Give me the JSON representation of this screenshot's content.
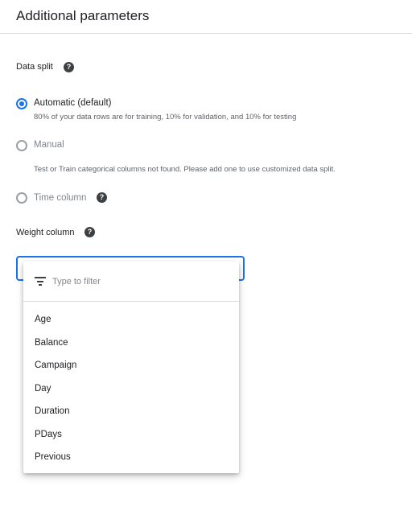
{
  "header": {
    "title": "Additional parameters"
  },
  "data_split": {
    "label": "Data split",
    "help_glyph": "?",
    "options": [
      {
        "label": "Automatic (default)",
        "description": "80% of your data rows are for training, 10% for validation, and 10% for testing",
        "selected": true,
        "disabled": false
      },
      {
        "label": "Manual",
        "description": "Test or Train categorical columns not found. Please add one to use customized data split.",
        "selected": false,
        "disabled": true
      },
      {
        "label": "Time column",
        "description": "",
        "selected": false,
        "disabled": true
      }
    ]
  },
  "weight_column": {
    "label": "Weight column",
    "help_glyph": "?",
    "filter": {
      "placeholder": "Type to filter",
      "value": ""
    },
    "options": [
      "Age",
      "Balance",
      "Campaign",
      "Day",
      "Duration",
      "PDays",
      "Previous"
    ]
  },
  "colors": {
    "accent": "#1a73e8",
    "text": "#202124",
    "secondary_text": "#5f6368",
    "disabled_text": "#80868b"
  },
  "icons": [
    "help-icon",
    "filter-icon"
  ]
}
